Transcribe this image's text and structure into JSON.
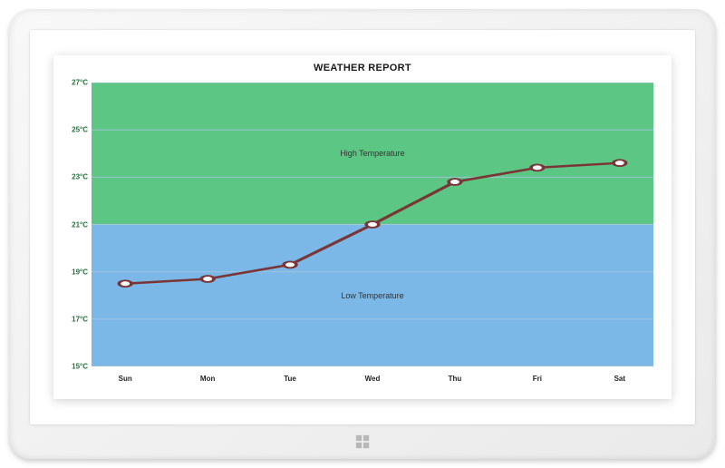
{
  "title": "WEATHER REPORT",
  "chart_data": {
    "type": "line",
    "categories": [
      "Sun",
      "Mon",
      "Tue",
      "Wed",
      "Thu",
      "Fri",
      "Sat"
    ],
    "values": [
      18.5,
      18.7,
      19.3,
      21.0,
      22.8,
      23.4,
      23.6
    ],
    "xlabel": "",
    "ylabel": "",
    "ylim": [
      15,
      27
    ],
    "y_ticks": [
      "27°C",
      "25°C",
      "23°C",
      "21°C",
      "19°C",
      "17°C",
      "15°C"
    ],
    "zones": [
      {
        "name": "High Temperature",
        "from": 21,
        "to": 27,
        "color": "#5cc784"
      },
      {
        "name": "Low Temperature",
        "from": 15,
        "to": 21,
        "color": "#7bb8e8"
      }
    ],
    "gridline_color": "#a5c3dd",
    "line_color": "#7a3636",
    "marker_fill": "#ffffff",
    "marker_stroke": "#7a3636"
  }
}
